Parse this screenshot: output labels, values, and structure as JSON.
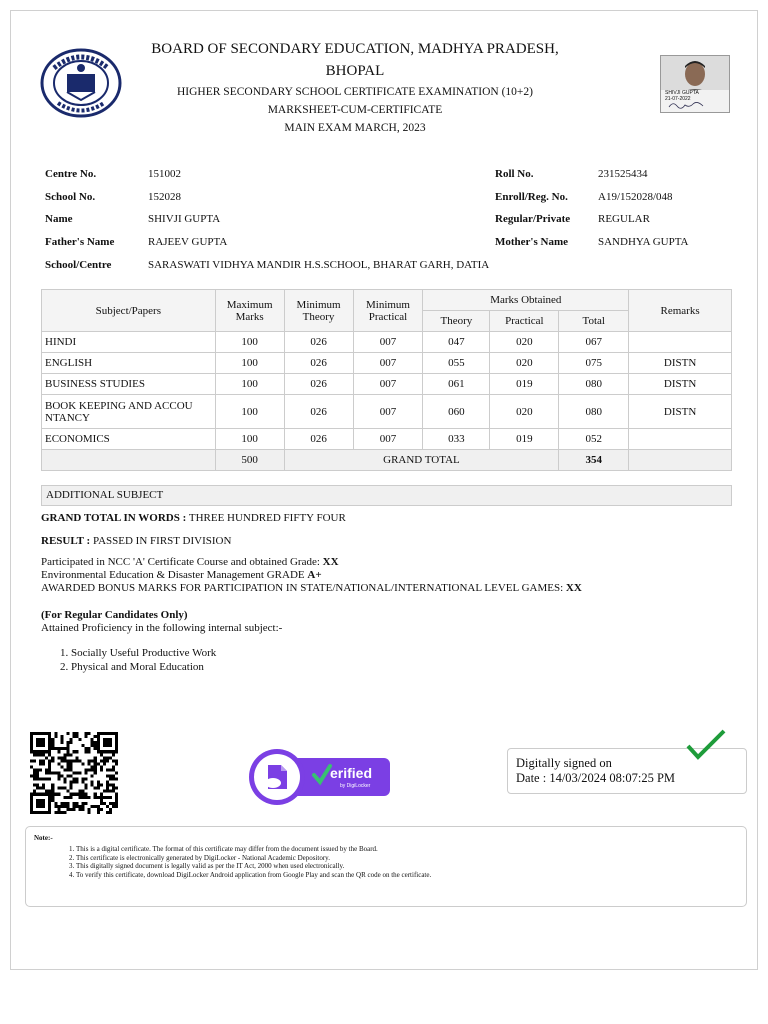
{
  "header": {
    "board_line1": "BOARD OF SECONDARY EDUCATION, MADHYA PRADESH,",
    "board_line2": "BHOPAL",
    "exam": "HIGHER SECONDARY SCHOOL CERTIFICATE EXAMINATION (10+2)",
    "doc_type": "MARKSHEET-CUM-CERTIFICATE",
    "session": "MAIN EXAM MARCH, 2023",
    "photo_caption": "SHIVJI GUPTA",
    "photo_date": "21-07-2022"
  },
  "student": {
    "centre_label": "Centre No.",
    "centre": "151002",
    "school_no_label": "School No.",
    "school_no": "152028",
    "name_label": "Name",
    "name": "SHIVJI GUPTA",
    "father_label": "Father's Name",
    "father": "RAJEEV GUPTA",
    "school_label": "School/Centre",
    "school": "SARASWATI VIDHYA MANDIR H.S.SCHOOL, BHARAT GARH, DATIA",
    "roll_label": "Roll No.",
    "roll": "231525434",
    "enroll_label": "Enroll/Reg. No.",
    "enroll": "A19/152028/048",
    "regular_label": "Regular/Private",
    "regular": "REGULAR",
    "mother_label": "Mother's Name",
    "mother": "SANDHYA GUPTA"
  },
  "table": {
    "h_subject": "Subject/Papers",
    "h_max1": "Maximum",
    "h_max2": "Marks",
    "h_min_th1": "Minimum",
    "h_min_th2": "Theory",
    "h_min_pr1": "Minimum",
    "h_min_pr2": "Practical",
    "h_obtained": "Marks Obtained",
    "h_theory": "Theory",
    "h_practical": "Practical",
    "h_total": "Total",
    "h_remarks": "Remarks",
    "rows": [
      {
        "subject": "HINDI",
        "max": "100",
        "min_th": "026",
        "min_pr": "007",
        "theory": "047",
        "practical": "020",
        "total": "067",
        "remarks": ""
      },
      {
        "subject": "ENGLISH",
        "max": "100",
        "min_th": "026",
        "min_pr": "007",
        "theory": "055",
        "practical": "020",
        "total": "075",
        "remarks": "DISTN"
      },
      {
        "subject": "BUSINESS STUDIES",
        "max": "100",
        "min_th": "026",
        "min_pr": "007",
        "theory": "061",
        "practical": "019",
        "total": "080",
        "remarks": "DISTN"
      },
      {
        "subject": "BOOK KEEPING AND ACCOU",
        "subject2": "NTANCY",
        "max": "100",
        "min_th": "026",
        "min_pr": "007",
        "theory": "060",
        "practical": "020",
        "total": "080",
        "remarks": "DISTN"
      },
      {
        "subject": "ECONOMICS",
        "max": "100",
        "min_th": "026",
        "min_pr": "007",
        "theory": "033",
        "practical": "019",
        "total": "052",
        "remarks": ""
      }
    ],
    "max_total": "500",
    "grand_total_label": "GRAND TOTAL",
    "grand_total": "354"
  },
  "additional_subject": "ADDITIONAL SUBJECT",
  "grand_words_label": "GRAND TOTAL IN WORDS :",
  "grand_words": "THREE HUNDRED FIFTY FOUR",
  "result_label": "RESULT :",
  "result": "PASSED IN FIRST DIVISION",
  "ncc_text": "Participated in NCC 'A' Certificate Course and obtained Grade:",
  "ncc_grade": "XX",
  "env_text": "Environmental Education & Disaster Management GRADE",
  "env_grade": "A+",
  "bonus_text": "AWARDED BONUS MARKS FOR PARTICIPATION IN STATE/NATIONAL/INTERNATIONAL LEVEL GAMES:",
  "bonus_value": "XX",
  "regular_note": "(For Regular Candidates Only)",
  "proficiency_intro": "Attained Proficiency in the following internal subject:-",
  "proficiency": [
    "Socially Useful Productive Work",
    "Physical and Moral Education"
  ],
  "badge": {
    "text": "erified",
    "sub": "by DigiLocker"
  },
  "signature": {
    "line1": "Digitally signed on",
    "line2": "Date : 14/03/2024 08:07:25 PM"
  },
  "notes": {
    "title": "Note:-",
    "items": [
      "This is a digital certificate. The format of this certificate may differ from the document issued by the Board.",
      "This certificate is electronically generated by DigiLocker - National Academic Depository.",
      "This digitally signed document is legally valid as per the IT Act, 2000 when used electronically.",
      "To verify this certificate, download DigiLocker Android application from Google Play and scan the QR code on the certificate."
    ]
  },
  "colors": {
    "badge_purple": "#7b3fe4",
    "tick_green": "#1e9c3a",
    "table_border": "#cccccc"
  }
}
